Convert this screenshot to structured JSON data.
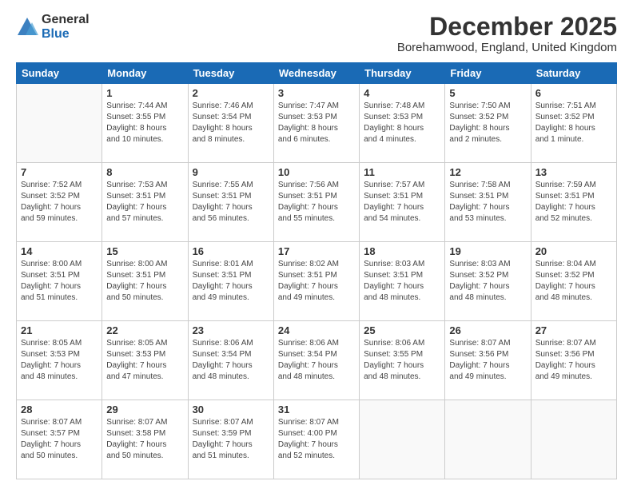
{
  "logo": {
    "general": "General",
    "blue": "Blue"
  },
  "header": {
    "month": "December 2025",
    "location": "Borehamwood, England, United Kingdom"
  },
  "days_of_week": [
    "Sunday",
    "Monday",
    "Tuesday",
    "Wednesday",
    "Thursday",
    "Friday",
    "Saturday"
  ],
  "weeks": [
    [
      {
        "day": "",
        "info": ""
      },
      {
        "day": "1",
        "info": "Sunrise: 7:44 AM\nSunset: 3:55 PM\nDaylight: 8 hours\nand 10 minutes."
      },
      {
        "day": "2",
        "info": "Sunrise: 7:46 AM\nSunset: 3:54 PM\nDaylight: 8 hours\nand 8 minutes."
      },
      {
        "day": "3",
        "info": "Sunrise: 7:47 AM\nSunset: 3:53 PM\nDaylight: 8 hours\nand 6 minutes."
      },
      {
        "day": "4",
        "info": "Sunrise: 7:48 AM\nSunset: 3:53 PM\nDaylight: 8 hours\nand 4 minutes."
      },
      {
        "day": "5",
        "info": "Sunrise: 7:50 AM\nSunset: 3:52 PM\nDaylight: 8 hours\nand 2 minutes."
      },
      {
        "day": "6",
        "info": "Sunrise: 7:51 AM\nSunset: 3:52 PM\nDaylight: 8 hours\nand 1 minute."
      }
    ],
    [
      {
        "day": "7",
        "info": "Sunrise: 7:52 AM\nSunset: 3:52 PM\nDaylight: 7 hours\nand 59 minutes."
      },
      {
        "day": "8",
        "info": "Sunrise: 7:53 AM\nSunset: 3:51 PM\nDaylight: 7 hours\nand 57 minutes."
      },
      {
        "day": "9",
        "info": "Sunrise: 7:55 AM\nSunset: 3:51 PM\nDaylight: 7 hours\nand 56 minutes."
      },
      {
        "day": "10",
        "info": "Sunrise: 7:56 AM\nSunset: 3:51 PM\nDaylight: 7 hours\nand 55 minutes."
      },
      {
        "day": "11",
        "info": "Sunrise: 7:57 AM\nSunset: 3:51 PM\nDaylight: 7 hours\nand 54 minutes."
      },
      {
        "day": "12",
        "info": "Sunrise: 7:58 AM\nSunset: 3:51 PM\nDaylight: 7 hours\nand 53 minutes."
      },
      {
        "day": "13",
        "info": "Sunrise: 7:59 AM\nSunset: 3:51 PM\nDaylight: 7 hours\nand 52 minutes."
      }
    ],
    [
      {
        "day": "14",
        "info": "Sunrise: 8:00 AM\nSunset: 3:51 PM\nDaylight: 7 hours\nand 51 minutes."
      },
      {
        "day": "15",
        "info": "Sunrise: 8:00 AM\nSunset: 3:51 PM\nDaylight: 7 hours\nand 50 minutes."
      },
      {
        "day": "16",
        "info": "Sunrise: 8:01 AM\nSunset: 3:51 PM\nDaylight: 7 hours\nand 49 minutes."
      },
      {
        "day": "17",
        "info": "Sunrise: 8:02 AM\nSunset: 3:51 PM\nDaylight: 7 hours\nand 49 minutes."
      },
      {
        "day": "18",
        "info": "Sunrise: 8:03 AM\nSunset: 3:51 PM\nDaylight: 7 hours\nand 48 minutes."
      },
      {
        "day": "19",
        "info": "Sunrise: 8:03 AM\nSunset: 3:52 PM\nDaylight: 7 hours\nand 48 minutes."
      },
      {
        "day": "20",
        "info": "Sunrise: 8:04 AM\nSunset: 3:52 PM\nDaylight: 7 hours\nand 48 minutes."
      }
    ],
    [
      {
        "day": "21",
        "info": "Sunrise: 8:05 AM\nSunset: 3:53 PM\nDaylight: 7 hours\nand 48 minutes."
      },
      {
        "day": "22",
        "info": "Sunrise: 8:05 AM\nSunset: 3:53 PM\nDaylight: 7 hours\nand 47 minutes."
      },
      {
        "day": "23",
        "info": "Sunrise: 8:06 AM\nSunset: 3:54 PM\nDaylight: 7 hours\nand 48 minutes."
      },
      {
        "day": "24",
        "info": "Sunrise: 8:06 AM\nSunset: 3:54 PM\nDaylight: 7 hours\nand 48 minutes."
      },
      {
        "day": "25",
        "info": "Sunrise: 8:06 AM\nSunset: 3:55 PM\nDaylight: 7 hours\nand 48 minutes."
      },
      {
        "day": "26",
        "info": "Sunrise: 8:07 AM\nSunset: 3:56 PM\nDaylight: 7 hours\nand 49 minutes."
      },
      {
        "day": "27",
        "info": "Sunrise: 8:07 AM\nSunset: 3:56 PM\nDaylight: 7 hours\nand 49 minutes."
      }
    ],
    [
      {
        "day": "28",
        "info": "Sunrise: 8:07 AM\nSunset: 3:57 PM\nDaylight: 7 hours\nand 50 minutes."
      },
      {
        "day": "29",
        "info": "Sunrise: 8:07 AM\nSunset: 3:58 PM\nDaylight: 7 hours\nand 50 minutes."
      },
      {
        "day": "30",
        "info": "Sunrise: 8:07 AM\nSunset: 3:59 PM\nDaylight: 7 hours\nand 51 minutes."
      },
      {
        "day": "31",
        "info": "Sunrise: 8:07 AM\nSunset: 4:00 PM\nDaylight: 7 hours\nand 52 minutes."
      },
      {
        "day": "",
        "info": ""
      },
      {
        "day": "",
        "info": ""
      },
      {
        "day": "",
        "info": ""
      }
    ]
  ]
}
